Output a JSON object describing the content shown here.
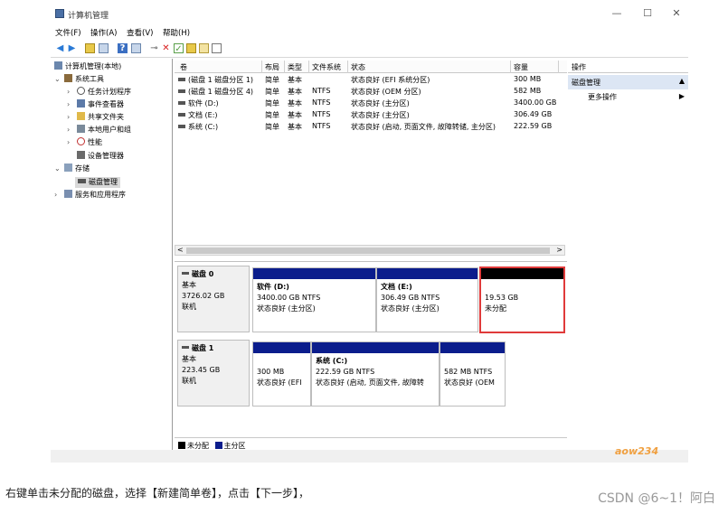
{
  "window": {
    "title": "计算机管理",
    "controls": {
      "minimize": "—",
      "maximize": "☐",
      "close": "✕"
    }
  },
  "menu": [
    "文件(F)",
    "操作(A)",
    "查看(V)",
    "帮助(H)"
  ],
  "tree": {
    "root": "计算机管理(本地)",
    "system_tools": "系统工具",
    "task_scheduler": "任务计划程序",
    "event_viewer": "事件查看器",
    "shared_folders": "共享文件夹",
    "local_users": "本地用户和组",
    "performance": "性能",
    "device_manager": "设备管理器",
    "storage": "存储",
    "disk_management": "磁盘管理",
    "services_apps": "服务和应用程序"
  },
  "volume_list": {
    "headers": [
      "卷",
      "布局",
      "类型",
      "文件系统",
      "状态",
      "容量"
    ],
    "rows": [
      [
        "(磁盘 1 磁盘分区 1)",
        "简单",
        "基本",
        "",
        "状态良好 (EFI 系统分区)",
        "300 MB"
      ],
      [
        "(磁盘 1 磁盘分区 4)",
        "简单",
        "基本",
        "NTFS",
        "状态良好 (OEM 分区)",
        "582 MB"
      ],
      [
        "软件 (D:)",
        "简单",
        "基本",
        "NTFS",
        "状态良好 (主分区)",
        "3400.00 GB"
      ],
      [
        "文档 (E:)",
        "简单",
        "基本",
        "NTFS",
        "状态良好 (主分区)",
        "306.49 GB"
      ],
      [
        "系统 (C:)",
        "简单",
        "基本",
        "NTFS",
        "状态良好 (启动, 页面文件, 故障转储, 主分区)",
        "222.59 GB"
      ]
    ],
    "scroll_left": "<",
    "scroll_right": ">"
  },
  "disks": [
    {
      "name": "磁盘 0",
      "type": "基本",
      "size": "3726.02 GB",
      "status": "联机",
      "partitions": [
        {
          "title": "软件  (D:)",
          "size": "3400.00 GB NTFS",
          "status": "状态良好 (主分区)"
        },
        {
          "title": "文档  (E:)",
          "size": "306.49 GB NTFS",
          "status": "状态良好 (主分区)"
        },
        {
          "title": "",
          "size": "19.53 GB",
          "status": "未分配"
        }
      ]
    },
    {
      "name": "磁盘 1",
      "type": "基本",
      "size": "223.45 GB",
      "status": "联机",
      "partitions": [
        {
          "title": "",
          "size": "300 MB",
          "status": "状态良好 (EFI"
        },
        {
          "title": "系统  (C:)",
          "size": "222.59 GB NTFS",
          "status": "状态良好 (启动, 页面文件, 故障转"
        },
        {
          "title": "",
          "size": "582 MB NTFS",
          "status": "状态良好 (OEM"
        }
      ]
    }
  ],
  "legend": {
    "unallocated": "未分配",
    "primary": "主分区"
  },
  "actions": {
    "header": "操作",
    "group": "磁盘管理",
    "more": "更多操作"
  },
  "caption": "右键单击未分配的磁盘，选择【新建简单卷】，点击【下一步】，",
  "credit": "CSDN @6~1！阿白",
  "watermark": "aow234",
  "colors": {
    "partition_bar": "#0b1d8c",
    "unallocated_bar": "#000000",
    "highlight": "#e03a3a"
  }
}
